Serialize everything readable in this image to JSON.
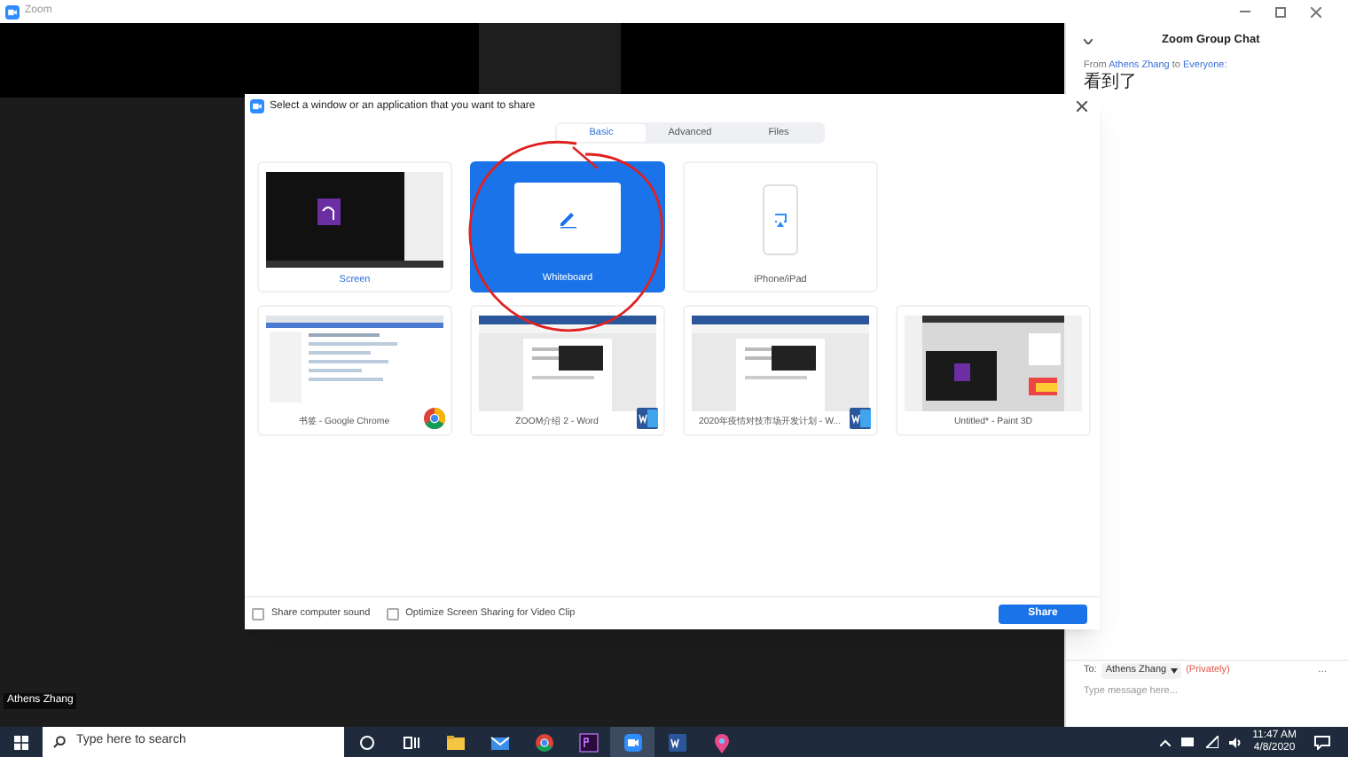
{
  "window": {
    "title": "Zoom"
  },
  "participant_name": "Athens Zhang",
  "dialog": {
    "title": "Select a window or an application that you want to share",
    "tabs": [
      {
        "label": "Basic",
        "selected": true
      },
      {
        "label": "Advanced",
        "selected": false
      },
      {
        "label": "Files",
        "selected": false
      }
    ],
    "sources": [
      {
        "kind": "screen",
        "label": "Screen",
        "selected": false
      },
      {
        "kind": "whiteboard",
        "label": "Whiteboard",
        "selected": true
      },
      {
        "kind": "phone",
        "label": "iPhone/iPad",
        "selected": false
      },
      {
        "kind": "chrome",
        "label": "书签 - Google Chrome",
        "selected": false
      },
      {
        "kind": "word",
        "label": "ZOOM介绍 2 - Word",
        "selected": false
      },
      {
        "kind": "word",
        "label": "2020年疫情对技市场开发计划 - W...",
        "selected": false
      },
      {
        "kind": "paint",
        "label": "Untitled* - Paint 3D",
        "selected": false
      }
    ],
    "options": [
      {
        "label": "Share computer sound",
        "checked": false
      },
      {
        "label": "Optimize Screen Sharing for Video Clip",
        "checked": false
      }
    ],
    "share_button": "Share"
  },
  "chat": {
    "title": "Zoom Group Chat",
    "messages": [
      {
        "from_prefix": "From",
        "sender": "Athens Zhang",
        "to_word": "to",
        "recipient": "Everyone:",
        "text": "看到了"
      }
    ],
    "to_label": "To:",
    "recipient": "Athens Zhang",
    "privacy": "(Privately)",
    "placeholder": "Type message here...",
    "more": "..."
  },
  "taskbar": {
    "search_placeholder": "Type here to search",
    "time": "11:47 AM",
    "date": "4/8/2020"
  }
}
